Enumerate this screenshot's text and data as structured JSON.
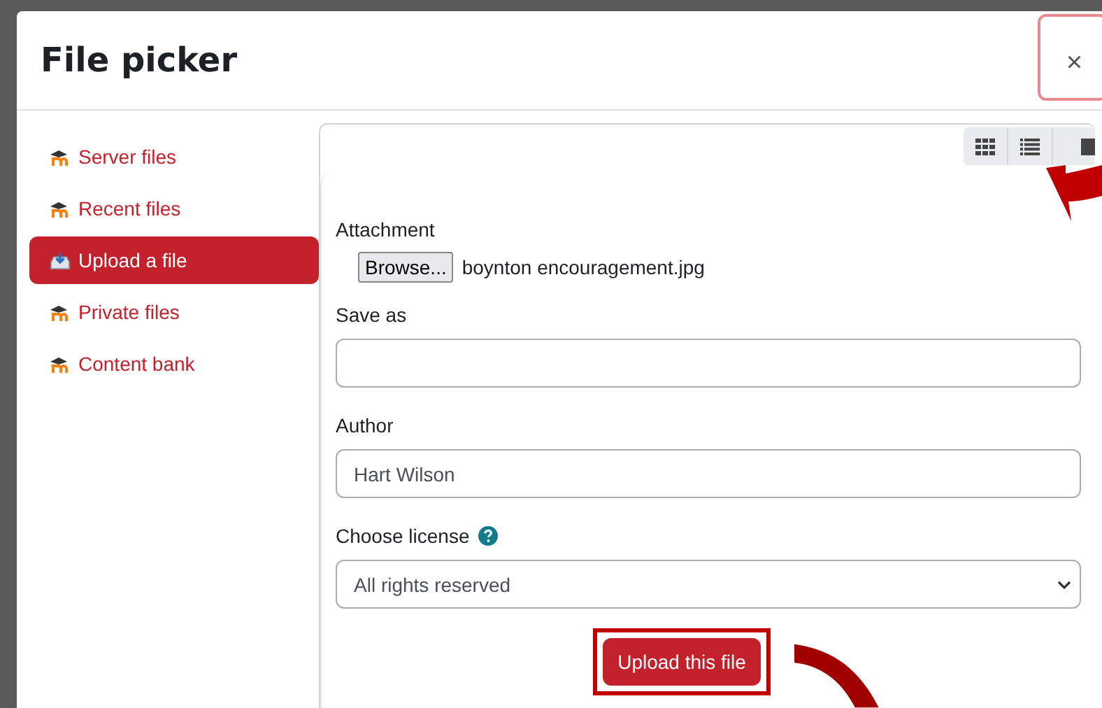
{
  "dialog": {
    "title": "File picker",
    "close": "×"
  },
  "sidebar": {
    "items": [
      {
        "label": "Server files",
        "kind": "repository",
        "selected": false
      },
      {
        "label": "Recent files",
        "kind": "repository",
        "selected": false
      },
      {
        "label": "Upload a file",
        "kind": "upload",
        "selected": true
      },
      {
        "label": "Private files",
        "kind": "repository",
        "selected": false
      },
      {
        "label": "Content bank",
        "kind": "repository",
        "selected": false
      }
    ]
  },
  "form": {
    "attachment": {
      "label": "Attachment",
      "button": "Browse...",
      "file": "boynton encouragement.jpg"
    },
    "save_as": {
      "label": "Save as"
    },
    "author": {
      "label": "Author",
      "value": "Hart Wilson"
    },
    "license": {
      "label": "Choose license",
      "value": "All rights reserved"
    },
    "submit": "Upload this file"
  }
}
